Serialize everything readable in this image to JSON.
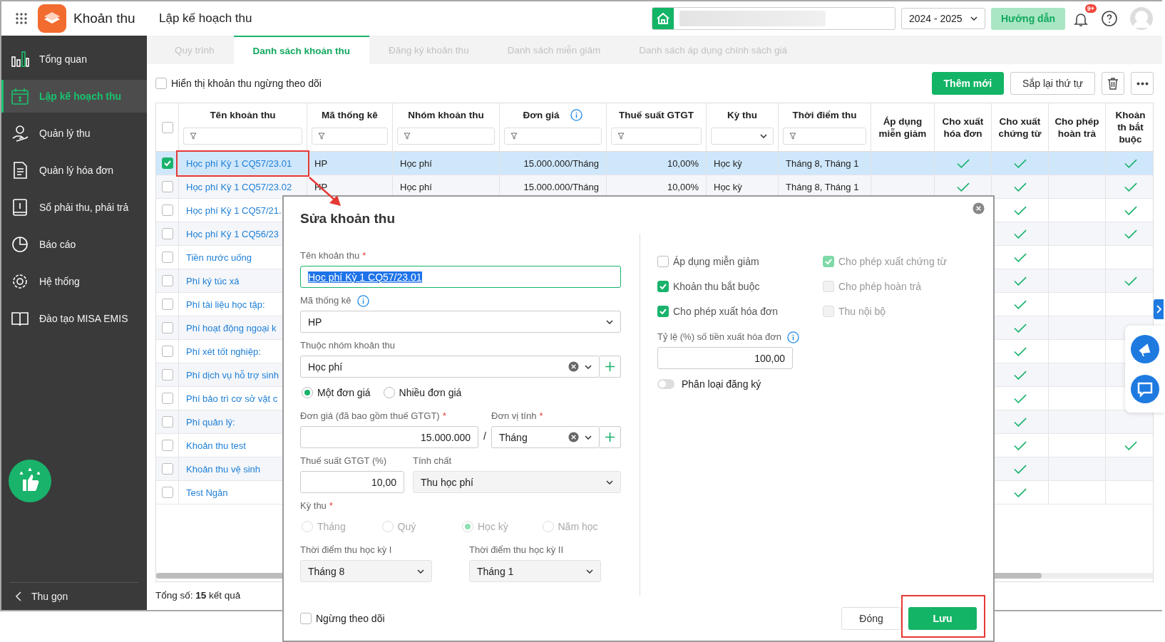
{
  "app": {
    "name": "Khoản thu",
    "page_title": "Lập kế hoạch thu"
  },
  "topbar": {
    "school_year": "2024 - 2025",
    "guide_button": "Hướng dẫn",
    "notification_badge": "9+"
  },
  "sidebar": {
    "items": [
      {
        "label": "Tổng quan",
        "selected": false
      },
      {
        "label": "Lập kế hoạch thu",
        "selected": true
      },
      {
        "label": "Quản lý thu",
        "selected": false
      },
      {
        "label": "Quản lý hóa đơn",
        "selected": false
      },
      {
        "label": "Sổ phải thu, phải trả",
        "selected": false
      },
      {
        "label": "Báo cáo",
        "selected": false
      },
      {
        "label": "Hệ thống",
        "selected": false
      },
      {
        "label": "Đào tạo MISA EMIS",
        "selected": false
      }
    ],
    "collapse": "Thu gọn"
  },
  "tabs": [
    {
      "label": "Quy trình",
      "selected": false
    },
    {
      "label": "Danh sách khoản thu",
      "selected": true
    },
    {
      "label": "Đăng ký khoản thu",
      "selected": false
    },
    {
      "label": "Danh sách miễn giảm",
      "selected": false
    },
    {
      "label": "Danh sách áp dụng chính sách giá",
      "selected": false
    }
  ],
  "toolbar": {
    "show_inactive": {
      "label": "Hiển thị khoản thu ngừng theo dõi",
      "checked": false
    },
    "add_button": "Thêm mới",
    "reorder_button": "Sắp lại thứ tự"
  },
  "table": {
    "all_selected": false,
    "columns": [
      {
        "label": "Tên khoản thu",
        "kind": "filter"
      },
      {
        "label": "Mã thống kê",
        "kind": "filter"
      },
      {
        "label": "Nhóm khoản thu",
        "kind": "filter"
      },
      {
        "label": "Đơn giá",
        "kind": "filter",
        "info": true
      },
      {
        "label": "Thuế suất GTGT",
        "kind": "filter"
      },
      {
        "label": "Kỳ thu",
        "kind": "dropdown"
      },
      {
        "label": "Thời điểm thu",
        "kind": "filter"
      },
      {
        "label": "Áp dụng miễn giảm",
        "kind": "plain"
      },
      {
        "label": "Cho xuất hóa đơn",
        "kind": "plain"
      },
      {
        "label": "Cho xuất chứng từ",
        "kind": "plain"
      },
      {
        "label": "Cho phép hoàn trả",
        "kind": "plain"
      },
      {
        "label": "Khoản th bắt buộc",
        "kind": "plain"
      }
    ],
    "rows": [
      {
        "selected": true,
        "name": "Học phí Kỳ 1 CQ57/23.01",
        "code": "HP",
        "group": "Học phí",
        "price": "15.000.000/Tháng",
        "vat": "10,00%",
        "period": "Học kỳ",
        "time": "Tháng 8, Tháng 1",
        "exemption": false,
        "invoice": true,
        "voucher": true,
        "refund": false,
        "mandatory": true
      },
      {
        "selected": false,
        "name": "Học phí Kỳ 1 CQ57/23.02",
        "code": "HP",
        "group": "Học phí",
        "price": "15.000.000/Tháng",
        "vat": "10,00%",
        "period": "Học kỳ",
        "time": "Tháng 8, Tháng 1",
        "exemption": false,
        "invoice": true,
        "voucher": true,
        "refund": false,
        "mandatory": true
      },
      {
        "selected": false,
        "name": "Học phí Kỳ 1 CQ57/21.",
        "voucher": true,
        "refund": false,
        "mandatory": true
      },
      {
        "selected": false,
        "name": "Học phí Kỳ 1 CQ56/23",
        "voucher": true,
        "refund": false,
        "mandatory": true
      },
      {
        "selected": false,
        "name": "Tiền nước uống",
        "voucher": true,
        "refund": false,
        "mandatory": false
      },
      {
        "selected": false,
        "name": "Phí ký túc xá",
        "voucher": true,
        "refund": false,
        "mandatory": true
      },
      {
        "selected": false,
        "name": "Phí tài liệu học tập:",
        "voucher": true,
        "refund": false,
        "mandatory": false
      },
      {
        "selected": false,
        "name": "Phí hoạt động ngoại k",
        "voucher": true,
        "refund": false,
        "mandatory": false
      },
      {
        "selected": false,
        "name": "Phí xét tốt nghiệp:",
        "voucher": true,
        "refund": false,
        "mandatory": false
      },
      {
        "selected": false,
        "name": "Phí dịch vụ hỗ trợ sinh",
        "voucher": true,
        "refund": false,
        "mandatory": false
      },
      {
        "selected": false,
        "name": "Phí bảo trì cơ sở vật c",
        "voucher": true,
        "refund": false,
        "mandatory": false
      },
      {
        "selected": false,
        "name": "Phí quản lý:",
        "voucher": true,
        "refund": false,
        "mandatory": false
      },
      {
        "selected": false,
        "name": "Khoản thu test",
        "voucher": true,
        "refund": false,
        "mandatory": true
      },
      {
        "selected": false,
        "name": "Khoản thu vệ sinh",
        "voucher": true,
        "refund": false,
        "mandatory": false
      },
      {
        "selected": false,
        "name": "Test Ngân",
        "voucher": true,
        "refund": false,
        "mandatory": false
      }
    ],
    "total": "Tổng số: **15** kết quả"
  },
  "dialog": {
    "title": "Sửa khoản thu",
    "name_field": {
      "label": "Tên khoản thu",
      "required_mark": "*",
      "value": "Học phí Kỳ 1 CQ57/23.01",
      "text_selected": true
    },
    "code_field": {
      "label": "Mã thống kê",
      "value": "HP"
    },
    "group_field": {
      "label": "Thuộc nhóm khoản thu",
      "value": "Học phí"
    },
    "price_modes": [
      {
        "label": "Một đơn giá",
        "selected": true
      },
      {
        "label": "Nhiều đơn giá",
        "selected": false
      }
    ],
    "price_field": {
      "label": "Đơn giá (đã bao gồm thuế GTGT)",
      "required_mark": "*",
      "value": "15.000.000"
    },
    "separator": "/",
    "unit_field": {
      "label": "Đơn vị tính",
      "required_mark": "*",
      "value": "Tháng"
    },
    "vat_field": {
      "label": "Thuế suất GTGT (%)",
      "value": "10,00"
    },
    "nature_field": {
      "label": "Tính chất",
      "value": "Thu học phí"
    },
    "period": {
      "label": "Kỳ thu",
      "required_mark": "*",
      "disabled": true,
      "options": [
        {
          "label": "Tháng",
          "selected": false
        },
        {
          "label": "Quý",
          "selected": false
        },
        {
          "label": "Học kỳ",
          "selected": true
        },
        {
          "label": "Năm học",
          "selected": false
        }
      ]
    },
    "term1_field": {
      "label": "Thời điểm thu học kỳ I",
      "value": "Tháng 8"
    },
    "term2_field": {
      "label": "Thời điểm thu học kỳ II",
      "value": "Tháng 1"
    },
    "options": [
      {
        "label": "Áp dụng miễn giảm",
        "checked": false,
        "disabled": false
      },
      {
        "label": "Cho phép xuất chứng từ",
        "checked": true,
        "disabled": true
      },
      {
        "label": "Khoản thu bắt buộc",
        "checked": true,
        "disabled": false
      },
      {
        "label": "Cho phép hoàn trả",
        "checked": false,
        "disabled": true
      },
      {
        "label": "Cho phép xuất hóa đơn",
        "checked": true,
        "disabled": false
      },
      {
        "label": "Thu nội bộ",
        "checked": false,
        "disabled": true
      }
    ],
    "ratio_field": {
      "label": "Tỷ lệ (%) số tiền xuất hóa đơn",
      "value": "100,00"
    },
    "register_toggle": {
      "label": "Phân loại đăng ký",
      "on": false
    },
    "stop_follow": {
      "label": "Ngừng theo dõi",
      "checked": false
    },
    "buttons": [
      {
        "label": "Đóng",
        "kind": "secondary"
      },
      {
        "label": "Lưu",
        "kind": "primary"
      }
    ]
  }
}
